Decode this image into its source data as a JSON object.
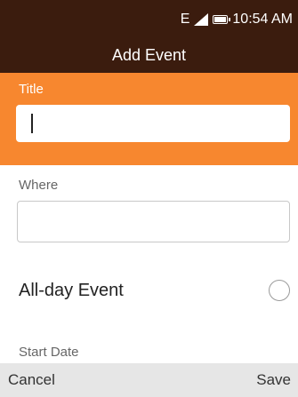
{
  "status_bar": {
    "network_type": "E",
    "time": "10:54 AM",
    "icons": [
      "signal-icon",
      "battery-icon"
    ]
  },
  "header": {
    "title": "Add Event"
  },
  "form": {
    "title": {
      "label": "Title",
      "value": "",
      "placeholder": ""
    },
    "where": {
      "label": "Where",
      "value": "",
      "placeholder": ""
    },
    "all_day": {
      "label": "All-day Event",
      "checked": false
    },
    "start_date": {
      "label": "Start Date"
    }
  },
  "softkeys": {
    "left": "Cancel",
    "right": "Save"
  },
  "colors": {
    "header_bg": "#3b1c0e",
    "accent": "#f7872f",
    "softkey_bg": "#e6e6e6"
  }
}
